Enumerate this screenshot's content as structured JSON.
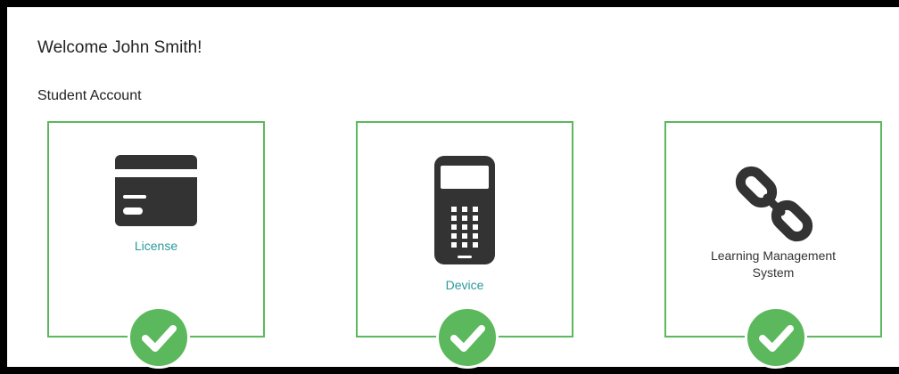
{
  "header": {
    "welcome_text": "Welcome John Smith!"
  },
  "account": {
    "section_label": "Student Account",
    "cards": [
      {
        "label": "License",
        "icon": "credit-card-icon",
        "status_icon": "check-circle-icon",
        "completed": true
      },
      {
        "label": "Device",
        "icon": "calculator-icon",
        "status_icon": "check-circle-icon",
        "completed": true
      },
      {
        "label_line1": "Learning Management",
        "label_line2": "System",
        "icon": "chain-link-icon",
        "status_icon": "check-circle-icon",
        "completed": true
      }
    ]
  },
  "colors": {
    "accent_green": "#5cb85c",
    "link_teal": "#2a9a9a",
    "icon_dark": "#333333",
    "frame_border": "#000000"
  }
}
